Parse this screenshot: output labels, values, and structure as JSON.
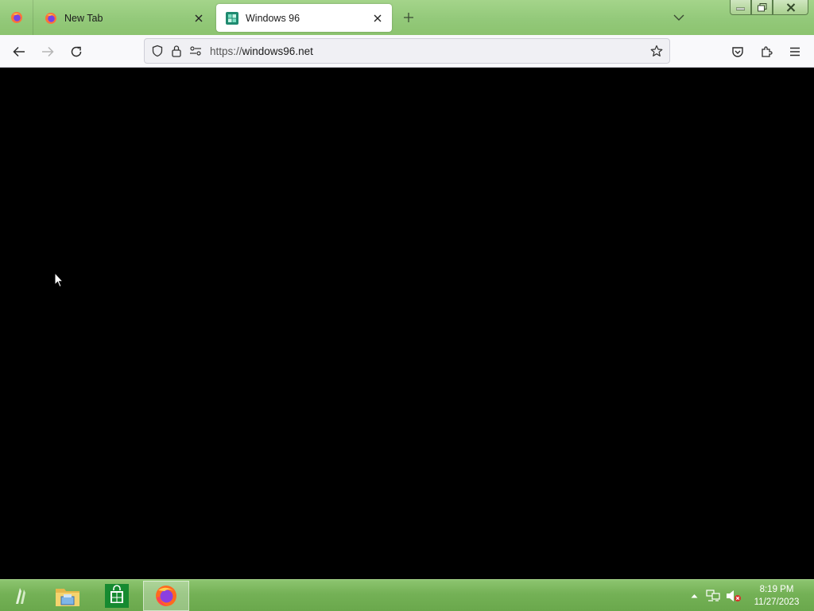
{
  "browser": {
    "tabs": [
      {
        "label": "New Tab",
        "active": false,
        "icon": "firefox-icon"
      },
      {
        "label": "Windows 96",
        "active": true,
        "icon": "windows96-favicon"
      }
    ],
    "url_scheme": "https://",
    "url_host": "windows96.net"
  },
  "taskbar": {
    "pinned": [
      "start-button",
      "file-explorer-icon",
      "store-icon",
      "firefox-icon"
    ],
    "clock_time": "8:19 PM",
    "clock_date": "11/27/2023"
  },
  "colors": {
    "theme_green": "#8cc46f",
    "page_background": "#000000"
  }
}
